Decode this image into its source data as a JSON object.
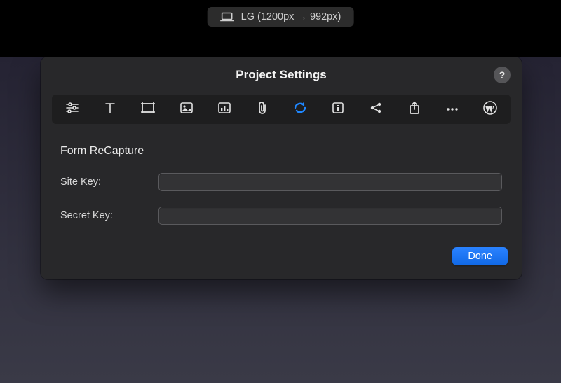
{
  "top_badge": {
    "label": "LG (1200px → 992px)"
  },
  "panel": {
    "title": "Project Settings",
    "help_label": "?"
  },
  "tabs": [
    {
      "name": "sliders-icon"
    },
    {
      "name": "text-icon"
    },
    {
      "name": "frame-icon"
    },
    {
      "name": "image-icon"
    },
    {
      "name": "analytics-icon"
    },
    {
      "name": "paperclip-icon"
    },
    {
      "name": "form-recapture-icon",
      "active": true
    },
    {
      "name": "info-icon"
    },
    {
      "name": "share-icon"
    },
    {
      "name": "upload-icon"
    },
    {
      "name": "more-icon"
    },
    {
      "name": "wordpress-icon"
    }
  ],
  "form": {
    "section_title": "Form ReCapture",
    "site_key_label": "Site Key:",
    "site_key_value": "",
    "secret_key_label": "Secret Key:",
    "secret_key_value": ""
  },
  "footer": {
    "done_label": "Done"
  }
}
